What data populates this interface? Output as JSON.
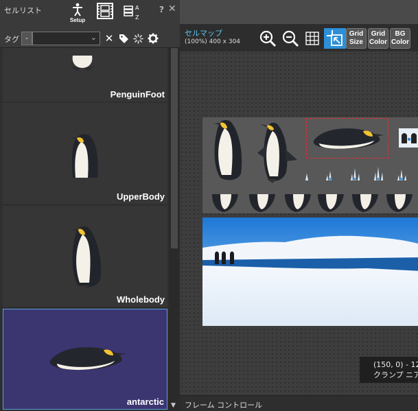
{
  "left_panel": {
    "title": "セルリスト",
    "setup_label": "Setup",
    "help": "?",
    "close": "✕",
    "tag_label": "タグ",
    "tag_minus": "-",
    "tag_select_value": "",
    "cells": [
      {
        "name": "PenguinFoot"
      },
      {
        "name": "UpperBody"
      },
      {
        "name": "Wholebody"
      },
      {
        "name": "antarctic"
      }
    ],
    "scroll_down": "▼"
  },
  "right_panel": {
    "title": "セルマップ",
    "info": "(100%) 400 x 304",
    "grid_size": {
      "line1": "Grid",
      "line2": "Size"
    },
    "grid_color": {
      "line1": "Grid",
      "line2": "Color"
    },
    "bg_color": {
      "line1": "BG",
      "line2": "Color"
    },
    "coord_line1": "(150, 0) - 12",
    "coord_line2": "クランプ ニア",
    "frame_control": "フレーム コントロール"
  },
  "colors": {
    "accent": "#2d8fd8",
    "title_cyan": "#5fc3ef",
    "selected_cell": "#3b3570",
    "selection_border": "#ffcc00"
  }
}
